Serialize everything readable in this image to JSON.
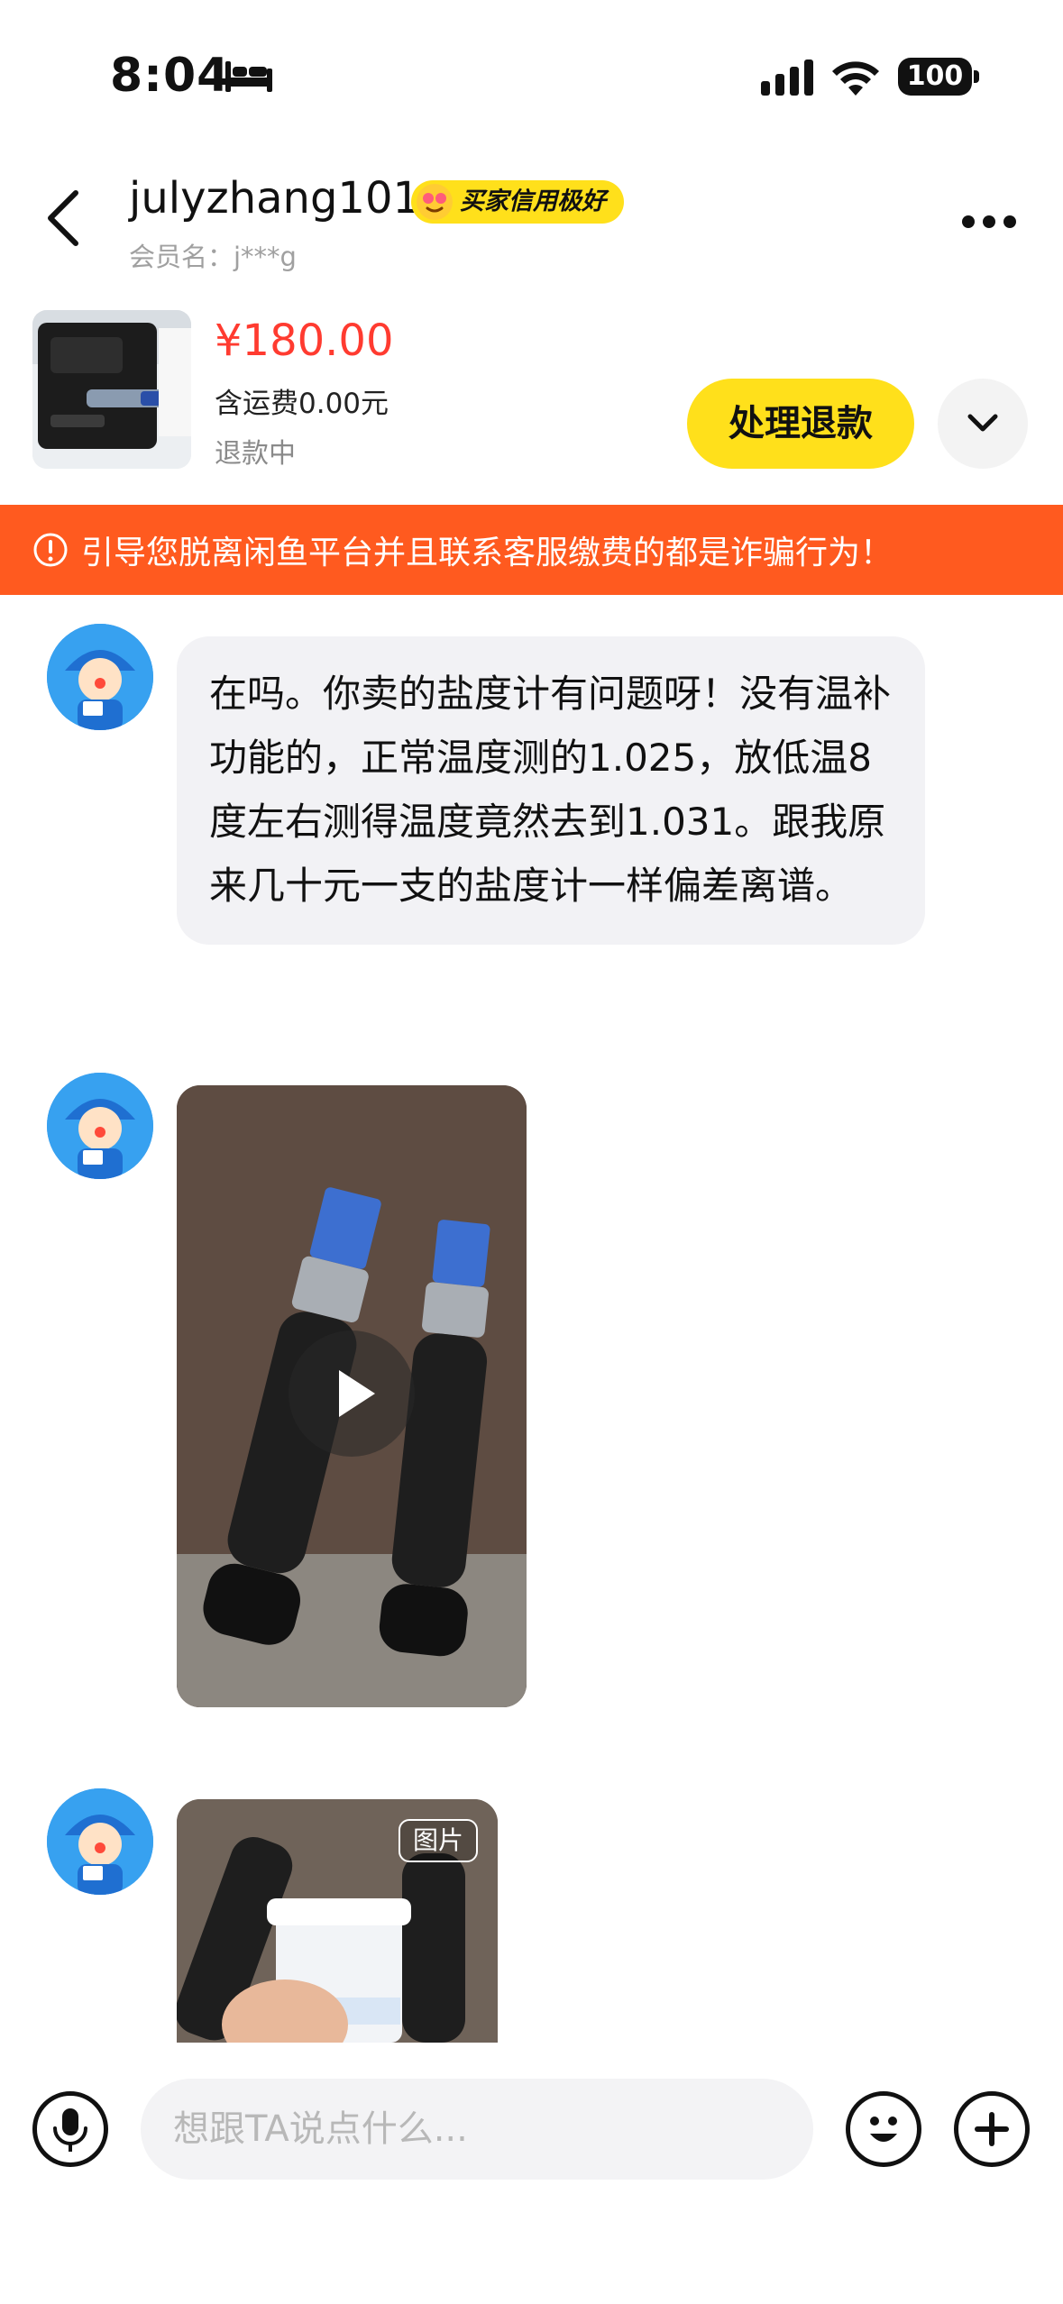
{
  "status_bar": {
    "time": "8:04",
    "battery": "100"
  },
  "header": {
    "user_name": "julyzhang101",
    "credit_badge": "买家信用极好",
    "member_name": "会员名：j***g"
  },
  "product": {
    "price": "¥180.00",
    "shipping": "含运费0.00元",
    "status": "退款中",
    "refund_button": "处理退款"
  },
  "warning": {
    "text": "引导您脱离闲鱼平台并且联系客服缴费的都是诈骗行为！"
  },
  "messages": [
    {
      "type": "text",
      "text": "在吗。你卖的盐度计有问题呀！没有温补功能的，正常温度测的1.025，放低温8度左右测得温度竟然去到1.031。跟我原来几十元一支的盐度计一样偏差离谱。"
    },
    {
      "type": "video"
    },
    {
      "type": "image",
      "tag": "图片"
    }
  ],
  "input_bar": {
    "placeholder": "想跟TA说点什么..."
  },
  "colors": {
    "accent_yellow": "#ffe01b",
    "price_red": "#ff3b30",
    "warning_orange": "#ff5a1f"
  }
}
